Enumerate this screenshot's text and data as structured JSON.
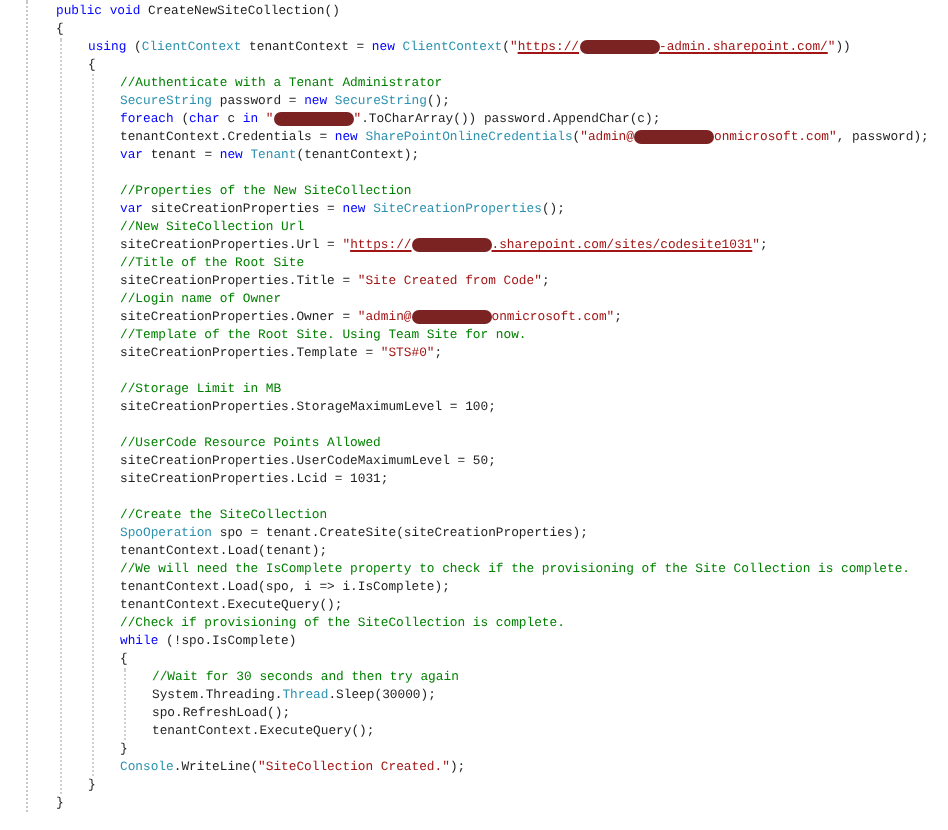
{
  "editor": {
    "lines": [
      {
        "kind": "code",
        "segments": [
          {
            "kind": "keyword",
            "text": "public void"
          },
          {
            "kind": "plain",
            "text": " CreateNewSiteCollection()"
          }
        ]
      },
      {
        "kind": "code",
        "segments": [
          {
            "kind": "plain",
            "text": "{"
          }
        ],
        "children": [
          {
            "kind": "code",
            "segments": [
              {
                "kind": "keyword",
                "text": "using"
              },
              {
                "kind": "plain",
                "text": " ("
              },
              {
                "kind": "type",
                "text": "ClientContext"
              },
              {
                "kind": "plain",
                "text": " tenantContext = "
              },
              {
                "kind": "keyword",
                "text": "new "
              },
              {
                "kind": "type",
                "text": "ClientContext"
              },
              {
                "kind": "plain",
                "text": "("
              },
              {
                "kind": "string",
                "text": "\""
              },
              {
                "kind": "link",
                "text": "https://"
              },
              {
                "kind": "redacted"
              },
              {
                "kind": "link",
                "text": "-admin.sharepoint.com/"
              },
              {
                "kind": "string",
                "text": "\""
              },
              {
                "kind": "plain",
                "text": "))"
              }
            ]
          },
          {
            "kind": "code",
            "segments": [
              {
                "kind": "plain",
                "text": "{"
              }
            ],
            "children": [
              {
                "kind": "code",
                "segments": [
                  {
                    "kind": "comment",
                    "text": "//Authenticate with a Tenant Administrator"
                  }
                ]
              },
              {
                "kind": "code",
                "segments": [
                  {
                    "kind": "type",
                    "text": "SecureString"
                  },
                  {
                    "kind": "plain",
                    "text": " password = "
                  },
                  {
                    "kind": "keyword",
                    "text": "new "
                  },
                  {
                    "kind": "type",
                    "text": "SecureString"
                  },
                  {
                    "kind": "plain",
                    "text": "();"
                  }
                ]
              },
              {
                "kind": "code",
                "segments": [
                  {
                    "kind": "keyword",
                    "text": "foreach"
                  },
                  {
                    "kind": "plain",
                    "text": " ("
                  },
                  {
                    "kind": "keyword",
                    "text": "char"
                  },
                  {
                    "kind": "plain",
                    "text": " c "
                  },
                  {
                    "kind": "keyword",
                    "text": "in "
                  },
                  {
                    "kind": "string",
                    "text": "\""
                  },
                  {
                    "kind": "redacted"
                  },
                  {
                    "kind": "string",
                    "text": "\""
                  },
                  {
                    "kind": "plain",
                    "text": ".ToCharArray()) password.AppendChar(c);"
                  }
                ]
              },
              {
                "kind": "code",
                "segments": [
                  {
                    "kind": "plain",
                    "text": "tenantContext.Credentials = "
                  },
                  {
                    "kind": "keyword",
                    "text": "new "
                  },
                  {
                    "kind": "type",
                    "text": "SharePointOnlineCredentials"
                  },
                  {
                    "kind": "plain",
                    "text": "("
                  },
                  {
                    "kind": "string",
                    "text": "\"admin@"
                  },
                  {
                    "kind": "redacted"
                  },
                  {
                    "kind": "string",
                    "text": "onmicrosoft.com\""
                  },
                  {
                    "kind": "plain",
                    "text": ", password);"
                  }
                ]
              },
              {
                "kind": "code",
                "segments": [
                  {
                    "kind": "keyword",
                    "text": "var"
                  },
                  {
                    "kind": "plain",
                    "text": " tenant = "
                  },
                  {
                    "kind": "keyword",
                    "text": "new "
                  },
                  {
                    "kind": "type",
                    "text": "Tenant"
                  },
                  {
                    "kind": "plain",
                    "text": "(tenantContext);"
                  }
                ]
              },
              {
                "kind": "blank"
              },
              {
                "kind": "code",
                "segments": [
                  {
                    "kind": "comment",
                    "text": "//Properties of the New SiteCollection"
                  }
                ]
              },
              {
                "kind": "code",
                "segments": [
                  {
                    "kind": "keyword",
                    "text": "var"
                  },
                  {
                    "kind": "plain",
                    "text": " siteCreationProperties = "
                  },
                  {
                    "kind": "keyword",
                    "text": "new "
                  },
                  {
                    "kind": "type",
                    "text": "SiteCreationProperties"
                  },
                  {
                    "kind": "plain",
                    "text": "();"
                  }
                ]
              },
              {
                "kind": "code",
                "segments": [
                  {
                    "kind": "comment",
                    "text": "//New SiteCollection Url"
                  }
                ]
              },
              {
                "kind": "code",
                "segments": [
                  {
                    "kind": "plain",
                    "text": "siteCreationProperties.Url = "
                  },
                  {
                    "kind": "string",
                    "text": "\""
                  },
                  {
                    "kind": "link",
                    "text": "https://"
                  },
                  {
                    "kind": "redacted"
                  },
                  {
                    "kind": "link",
                    "text": ".sharepoint.com/sites/codesite1031"
                  },
                  {
                    "kind": "string",
                    "text": "\""
                  },
                  {
                    "kind": "plain",
                    "text": ";"
                  }
                ]
              },
              {
                "kind": "code",
                "segments": [
                  {
                    "kind": "comment",
                    "text": "//Title of the Root Site"
                  }
                ]
              },
              {
                "kind": "code",
                "segments": [
                  {
                    "kind": "plain",
                    "text": "siteCreationProperties.Title = "
                  },
                  {
                    "kind": "string",
                    "text": "\"Site Created from Code\""
                  },
                  {
                    "kind": "plain",
                    "text": ";"
                  }
                ]
              },
              {
                "kind": "code",
                "segments": [
                  {
                    "kind": "comment",
                    "text": "//Login name of Owner"
                  }
                ]
              },
              {
                "kind": "code",
                "segments": [
                  {
                    "kind": "plain",
                    "text": "siteCreationProperties.Owner = "
                  },
                  {
                    "kind": "string",
                    "text": "\"admin@"
                  },
                  {
                    "kind": "redacted"
                  },
                  {
                    "kind": "string",
                    "text": "onmicrosoft.com\""
                  },
                  {
                    "kind": "plain",
                    "text": ";"
                  }
                ]
              },
              {
                "kind": "code",
                "segments": [
                  {
                    "kind": "comment",
                    "text": "//Template of the Root Site. Using Team Site for now."
                  }
                ]
              },
              {
                "kind": "code",
                "segments": [
                  {
                    "kind": "plain",
                    "text": "siteCreationProperties.Template = "
                  },
                  {
                    "kind": "string",
                    "text": "\"STS#0\""
                  },
                  {
                    "kind": "plain",
                    "text": ";"
                  }
                ]
              },
              {
                "kind": "blank"
              },
              {
                "kind": "code",
                "segments": [
                  {
                    "kind": "comment",
                    "text": "//Storage Limit in MB"
                  }
                ]
              },
              {
                "kind": "code",
                "segments": [
                  {
                    "kind": "plain",
                    "text": "siteCreationProperties.StorageMaximumLevel = 100;"
                  }
                ]
              },
              {
                "kind": "blank"
              },
              {
                "kind": "code",
                "segments": [
                  {
                    "kind": "comment",
                    "text": "//UserCode Resource Points Allowed"
                  }
                ]
              },
              {
                "kind": "code",
                "segments": [
                  {
                    "kind": "plain",
                    "text": "siteCreationProperties.UserCodeMaximumLevel = 50;"
                  }
                ]
              },
              {
                "kind": "code",
                "segments": [
                  {
                    "kind": "plain",
                    "text": "siteCreationProperties.Lcid = 1031;"
                  }
                ]
              },
              {
                "kind": "blank"
              },
              {
                "kind": "code",
                "segments": [
                  {
                    "kind": "comment",
                    "text": "//Create the SiteCollection"
                  }
                ]
              },
              {
                "kind": "code",
                "segments": [
                  {
                    "kind": "type",
                    "text": "SpoOperation"
                  },
                  {
                    "kind": "plain",
                    "text": " spo = tenant.CreateSite(siteCreationProperties);"
                  }
                ]
              },
              {
                "kind": "code",
                "segments": [
                  {
                    "kind": "plain",
                    "text": "tenantContext.Load(tenant);"
                  }
                ]
              },
              {
                "kind": "code",
                "segments": [
                  {
                    "kind": "comment",
                    "text": "//We will need the IsComplete property to check if the provisioning of the Site Collection is complete."
                  }
                ]
              },
              {
                "kind": "code",
                "segments": [
                  {
                    "kind": "plain",
                    "text": "tenantContext.Load(spo, i => i.IsComplete);"
                  }
                ]
              },
              {
                "kind": "code",
                "segments": [
                  {
                    "kind": "plain",
                    "text": "tenantContext.ExecuteQuery();"
                  }
                ]
              },
              {
                "kind": "code",
                "segments": [
                  {
                    "kind": "comment",
                    "text": "//Check if provisioning of the SiteCollection is complete."
                  }
                ]
              },
              {
                "kind": "code",
                "segments": [
                  {
                    "kind": "keyword",
                    "text": "while"
                  },
                  {
                    "kind": "plain",
                    "text": " (!spo.IsComplete)"
                  }
                ]
              },
              {
                "kind": "code",
                "segments": [
                  {
                    "kind": "plain",
                    "text": "{"
                  }
                ],
                "children": [
                  {
                    "kind": "code",
                    "segments": [
                      {
                        "kind": "comment",
                        "text": "//Wait for 30 seconds and then try again"
                      }
                    ]
                  },
                  {
                    "kind": "code",
                    "segments": [
                      {
                        "kind": "plain",
                        "text": "System.Threading."
                      },
                      {
                        "kind": "type",
                        "text": "Thread"
                      },
                      {
                        "kind": "plain",
                        "text": ".Sleep(30000);"
                      }
                    ]
                  },
                  {
                    "kind": "code",
                    "segments": [
                      {
                        "kind": "plain",
                        "text": "spo.RefreshLoad();"
                      }
                    ]
                  },
                  {
                    "kind": "code",
                    "segments": [
                      {
                        "kind": "plain",
                        "text": "tenantContext.ExecuteQuery();"
                      }
                    ]
                  }
                ]
              },
              {
                "kind": "code",
                "segments": [
                  {
                    "kind": "plain",
                    "text": "}"
                  }
                ]
              },
              {
                "kind": "code",
                "segments": [
                  {
                    "kind": "type",
                    "text": "Console"
                  },
                  {
                    "kind": "plain",
                    "text": ".WriteLine("
                  },
                  {
                    "kind": "string",
                    "text": "\"SiteCollection Created.\""
                  },
                  {
                    "kind": "plain",
                    "text": ");"
                  }
                ]
              }
            ]
          },
          {
            "kind": "code",
            "segments": [
              {
                "kind": "plain",
                "text": "}"
              }
            ]
          }
        ]
      },
      {
        "kind": "code",
        "segments": [
          {
            "kind": "plain",
            "text": "}"
          }
        ]
      }
    ]
  }
}
